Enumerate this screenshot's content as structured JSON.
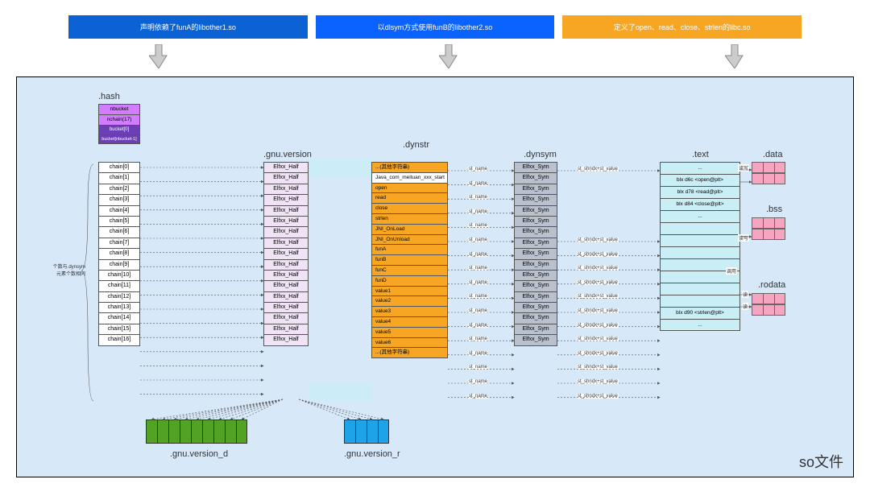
{
  "header": {
    "pill1": "声明依赖了funA的libother1.so",
    "pill2": "以dlsym方式使用funB的libother2.so",
    "pill3": "定义了open、read、close、strlen的libc.so"
  },
  "footer": {
    "so_label": "so文件"
  },
  "sections": {
    "hash": ".hash",
    "gnu_version": ".gnu.version",
    "dynstr": ".dynstr",
    "dynsym": ".dynsym",
    "text": ".text",
    "data": ".data",
    "bss": ".bss",
    "rodata": ".rodata",
    "gnu_version_d": ".gnu.version_d",
    "gnu_version_r": ".gnu.version_r"
  },
  "hash_cells": {
    "nbucket": "nbucket",
    "nchain": "nchain(17)",
    "bucket0": "bucket[0]",
    "bucketN": "bucket[nbucket-1]"
  },
  "chains": [
    "chain[0]",
    "chain[1]",
    "chain[2]",
    "chain[3]",
    "chain[4]",
    "chain[5]",
    "chain[6]",
    "chain[7]",
    "chain[8]",
    "chain[9]",
    "chain[10]",
    "chain[11]",
    "chain[12]",
    "chain[13]",
    "chain[14]",
    "chain[15]",
    "chain[16]"
  ],
  "note": "个数与.dynsym\n元素个数相同",
  "gnu_version_cells": [
    "Elfxx_Half",
    "Elfxx_Half",
    "Elfxx_Half",
    "Elfxx_Half",
    "Elfxx_Half",
    "Elfxx_Half",
    "Elfxx_Half",
    "Elfxx_Half",
    "Elfxx_Half",
    "Elfxx_Half",
    "Elfxx_Half",
    "Elfxx_Half",
    "Elfxx_Half",
    "Elfxx_Half",
    "Elfxx_Half",
    "Elfxx_Half",
    "Elfxx_Half"
  ],
  "dynstr": [
    {
      "cls": "o-top",
      "t": "...(其他字符串)"
    },
    {
      "cls": "w",
      "t": "Java_com_meituan_xxx_start"
    },
    {
      "cls": "o",
      "t": "open"
    },
    {
      "cls": "o",
      "t": "read"
    },
    {
      "cls": "o",
      "t": "close"
    },
    {
      "cls": "o",
      "t": "strlen"
    },
    {
      "cls": "o",
      "t": "JNI_OnLoad"
    },
    {
      "cls": "o",
      "t": "JNI_OnUnload"
    },
    {
      "cls": "o",
      "t": "funA"
    },
    {
      "cls": "o",
      "t": "funB"
    },
    {
      "cls": "o",
      "t": "funC"
    },
    {
      "cls": "o",
      "t": "funD"
    },
    {
      "cls": "o",
      "t": "value1"
    },
    {
      "cls": "o",
      "t": "value2"
    },
    {
      "cls": "o",
      "t": "value3"
    },
    {
      "cls": "o",
      "t": "value4"
    },
    {
      "cls": "o",
      "t": "value5"
    },
    {
      "cls": "o",
      "t": "value6"
    },
    {
      "cls": "o-top",
      "t": "...(其他字符串)"
    }
  ],
  "dynsym_label": "Elfxx_Sym",
  "dynsym_n": 17,
  "text_cells": [
    "...",
    "blx d6c <open@plt>",
    "blx d78 <read@plt>",
    "blx d84 <close@plt>",
    "...",
    "",
    "",
    "",
    "",
    "",
    "",
    "",
    "blx d90 <strlen@plt>",
    "..."
  ],
  "connectors": {
    "st_name": "st_name",
    "st_shndx": "st_shndx+st_value",
    "rw": "读写",
    "r": "读",
    "call": "调用"
  }
}
